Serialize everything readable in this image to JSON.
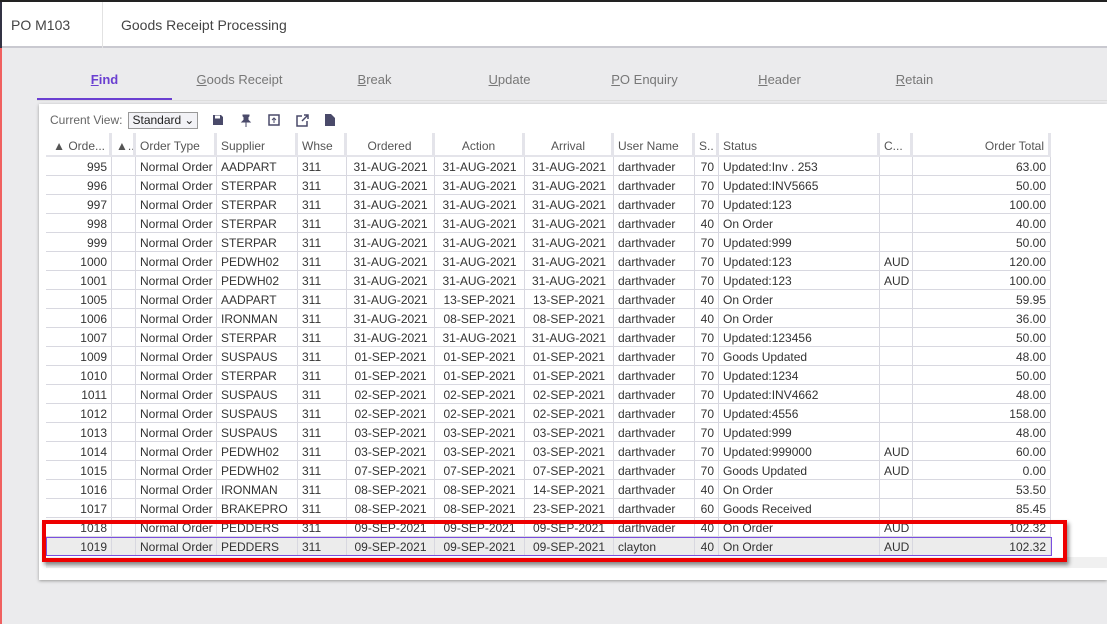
{
  "header": {
    "program": "PO M103",
    "title": "Goods Receipt Processing"
  },
  "tabs": [
    {
      "label": "Find",
      "active": true
    },
    {
      "label": "Goods Receipt"
    },
    {
      "label": "Break"
    },
    {
      "label": "Update"
    },
    {
      "label": "PO Enquiry"
    },
    {
      "label": "Header"
    },
    {
      "label": "Retain"
    }
  ],
  "toolbar": {
    "view_label": "Current View:",
    "view_value": "Standard",
    "icons": [
      "save-icon",
      "pin-icon",
      "restore-icon",
      "export-icon",
      "document-icon"
    ]
  },
  "colors": {
    "accent": "#6a3fd1",
    "highlight": "#ee0000"
  },
  "columns": [
    "▲ Orde...",
    "▲..",
    "Order Type",
    "Supplier",
    "Whse",
    "Ordered",
    "Action",
    "Arrival",
    "User Name",
    "S..",
    "Status",
    "C...",
    "Order Total"
  ],
  "rows": [
    [
      "995",
      "",
      "Normal Order",
      "AADPART",
      "311",
      "31-AUG-2021",
      "31-AUG-2021",
      "31-AUG-2021",
      "darthvader",
      "70",
      "Updated:Inv . 253",
      "",
      "63.00"
    ],
    [
      "996",
      "",
      "Normal Order",
      "STERPAR",
      "311",
      "31-AUG-2021",
      "31-AUG-2021",
      "31-AUG-2021",
      "darthvader",
      "70",
      "Updated:INV5665",
      "",
      "50.00"
    ],
    [
      "997",
      "",
      "Normal Order",
      "STERPAR",
      "311",
      "31-AUG-2021",
      "31-AUG-2021",
      "31-AUG-2021",
      "darthvader",
      "70",
      "Updated:123",
      "",
      "100.00"
    ],
    [
      "998",
      "",
      "Normal Order",
      "STERPAR",
      "311",
      "31-AUG-2021",
      "31-AUG-2021",
      "31-AUG-2021",
      "darthvader",
      "40",
      "On Order",
      "",
      "40.00"
    ],
    [
      "999",
      "",
      "Normal Order",
      "STERPAR",
      "311",
      "31-AUG-2021",
      "31-AUG-2021",
      "31-AUG-2021",
      "darthvader",
      "70",
      "Updated:999",
      "",
      "50.00"
    ],
    [
      "1000",
      "",
      "Normal Order",
      "PEDWH02",
      "311",
      "31-AUG-2021",
      "31-AUG-2021",
      "31-AUG-2021",
      "darthvader",
      "70",
      "Updated:123",
      "AUD",
      "120.00"
    ],
    [
      "1001",
      "",
      "Normal Order",
      "PEDWH02",
      "311",
      "31-AUG-2021",
      "31-AUG-2021",
      "31-AUG-2021",
      "darthvader",
      "70",
      "Updated:123",
      "AUD",
      "100.00"
    ],
    [
      "1005",
      "",
      "Normal Order",
      "AADPART",
      "311",
      "31-AUG-2021",
      "13-SEP-2021",
      "13-SEP-2021",
      "darthvader",
      "40",
      "On Order",
      "",
      "59.95"
    ],
    [
      "1006",
      "",
      "Normal Order",
      "IRONMAN",
      "311",
      "31-AUG-2021",
      "08-SEP-2021",
      "08-SEP-2021",
      "darthvader",
      "40",
      "On Order",
      "",
      "36.00"
    ],
    [
      "1007",
      "",
      "Normal Order",
      "STERPAR",
      "311",
      "31-AUG-2021",
      "31-AUG-2021",
      "31-AUG-2021",
      "darthvader",
      "70",
      "Updated:123456",
      "",
      "50.00"
    ],
    [
      "1009",
      "",
      "Normal Order",
      "SUSPAUS",
      "311",
      "01-SEP-2021",
      "01-SEP-2021",
      "01-SEP-2021",
      "darthvader",
      "70",
      "Goods Updated",
      "",
      "48.00"
    ],
    [
      "1010",
      "",
      "Normal Order",
      "STERPAR",
      "311",
      "01-SEP-2021",
      "01-SEP-2021",
      "01-SEP-2021",
      "darthvader",
      "70",
      "Updated:1234",
      "",
      "50.00"
    ],
    [
      "1011",
      "",
      "Normal Order",
      "SUSPAUS",
      "311",
      "02-SEP-2021",
      "02-SEP-2021",
      "02-SEP-2021",
      "darthvader",
      "70",
      "Updated:INV4662",
      "",
      "48.00"
    ],
    [
      "1012",
      "",
      "Normal Order",
      "SUSPAUS",
      "311",
      "02-SEP-2021",
      "02-SEP-2021",
      "02-SEP-2021",
      "darthvader",
      "70",
      "Updated:4556",
      "",
      "158.00"
    ],
    [
      "1013",
      "",
      "Normal Order",
      "SUSPAUS",
      "311",
      "03-SEP-2021",
      "03-SEP-2021",
      "03-SEP-2021",
      "darthvader",
      "70",
      "Updated:999",
      "",
      "48.00"
    ],
    [
      "1014",
      "",
      "Normal Order",
      "PEDWH02",
      "311",
      "03-SEP-2021",
      "03-SEP-2021",
      "03-SEP-2021",
      "darthvader",
      "70",
      "Updated:999000",
      "AUD",
      "60.00"
    ],
    [
      "1015",
      "",
      "Normal Order",
      "PEDWH02",
      "311",
      "07-SEP-2021",
      "07-SEP-2021",
      "07-SEP-2021",
      "darthvader",
      "70",
      "Goods Updated",
      "AUD",
      "0.00"
    ],
    [
      "1016",
      "",
      "Normal Order",
      "IRONMAN",
      "311",
      "08-SEP-2021",
      "08-SEP-2021",
      "14-SEP-2021",
      "darthvader",
      "40",
      "On Order",
      "",
      "53.50"
    ],
    [
      "1017",
      "",
      "Normal Order",
      "BRAKEPRO",
      "311",
      "08-SEP-2021",
      "08-SEP-2021",
      "23-SEP-2021",
      "darthvader",
      "60",
      "Goods Received",
      "",
      "85.45"
    ],
    [
      "1018",
      "",
      "Normal Order",
      "PEDDERS",
      "311",
      "09-SEP-2021",
      "09-SEP-2021",
      "09-SEP-2021",
      "darthvader",
      "40",
      "On Order",
      "AUD",
      "102.32"
    ],
    [
      "1019",
      "",
      "Normal Order",
      "PEDDERS",
      "311",
      "09-SEP-2021",
      "09-SEP-2021",
      "09-SEP-2021",
      "clayton",
      "40",
      "On Order",
      "AUD",
      "102.32"
    ]
  ],
  "selected_row": "1019"
}
